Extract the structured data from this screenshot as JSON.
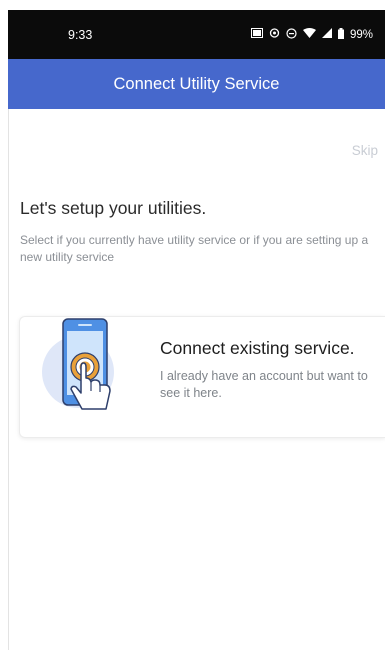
{
  "status_bar": {
    "time": "9:33",
    "battery": "99%",
    "icons": [
      "cast-icon",
      "nfc-icon",
      "do-not-disturb-icon",
      "wifi-icon",
      "cellular-icon",
      "battery-icon"
    ]
  },
  "app_bar": {
    "title": "Connect Utility Service",
    "color": "#4668cc"
  },
  "skip": {
    "label": "Skip"
  },
  "main": {
    "heading": "Let's setup your utilities.",
    "subtext": "Select if you currently have utility service or if you are setting up a new utility service"
  },
  "card": {
    "title": "Connect existing service.",
    "description": "I already have an account but want to see it here.",
    "icon": "phone-tap-icon",
    "accent": "#e9a13a"
  }
}
